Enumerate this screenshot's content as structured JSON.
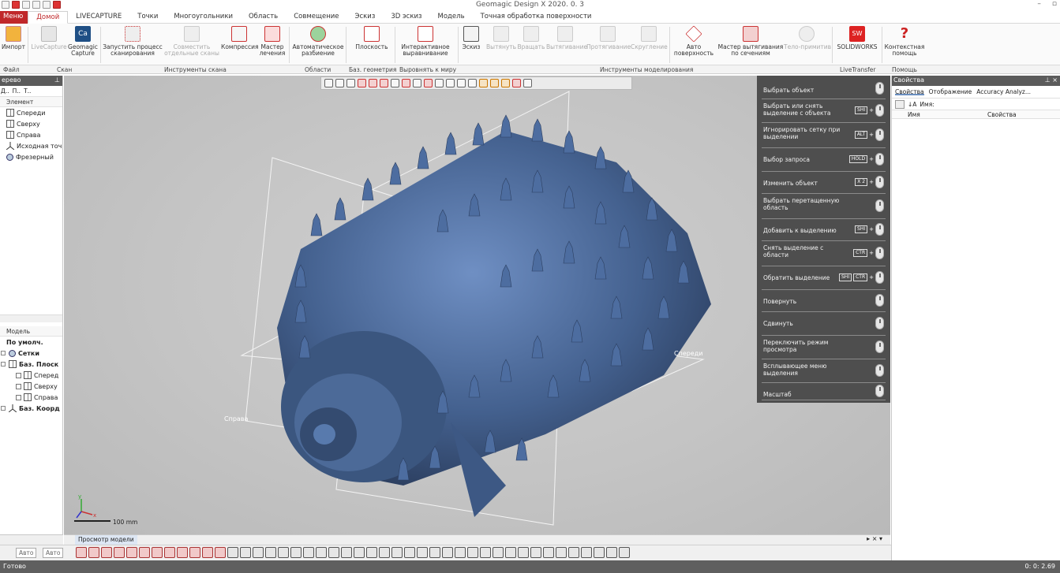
{
  "window": {
    "title": "Geomagic Design X 2020. 0. 3"
  },
  "tabs": [
    {
      "label": "Меню"
    },
    {
      "label": "Домой"
    },
    {
      "label": "LIVECAPTURE"
    },
    {
      "label": "Точки"
    },
    {
      "label": "Многоугольники"
    },
    {
      "label": "Область"
    },
    {
      "label": "Совмещение"
    },
    {
      "label": "Эскиз"
    },
    {
      "label": "3D эскиз"
    },
    {
      "label": "Модель"
    },
    {
      "label": "Точная обработка поверхности"
    }
  ],
  "ribbon": {
    "import": "Импорт",
    "livecapture": "LiveCapture",
    "geomagic_capture": "Geomagic Capture",
    "run_scan": "Запустить процесс сканирования",
    "combine_scans": "Совместить отдельные сканы",
    "compress": "Компрессия",
    "healing": "Мастер лечения",
    "auto_segment": "Автоматическое разбиение",
    "plane": "Плоскость",
    "interactive_align": "Интерактивное выравнивание",
    "sketch": "Эскиз",
    "extrude": "Вытянуть",
    "revolve": "Вращать",
    "sweep": "Вытягивание",
    "loft": "Протягивание",
    "fillet": "Скругление",
    "auto_surface": "Авто поверхность",
    "extract_wizard": "Мастер вытягивания по сечениям",
    "body_primitive": "Тело-примитив",
    "solidworks": "SOLIDWORKS",
    "context_help": "Контекстная помощь"
  },
  "groups": {
    "file": "Файл",
    "scan": "Скан",
    "scan_tools": "Инструменты скана",
    "regions": "Области",
    "base_geometry": "Баз. геометрия",
    "align_world": "Выровнять к миру",
    "modeling_tools": "Инструменты моделирования",
    "livetransfer": "LiveTransfer",
    "help": "Помощь"
  },
  "left_panel": {
    "title": "ерево",
    "tool_tabs": [
      "Д..",
      "П..",
      "Т.."
    ],
    "column": "Элемент",
    "tree": [
      "Спереди",
      "Сверху",
      "Справа",
      "Исходная точ",
      "Фрезерный"
    ],
    "model_header": "Модель",
    "model_tree": [
      {
        "label": "По умолч.",
        "bold": true
      },
      {
        "label": "Сетки",
        "bold": true
      },
      {
        "label": "Баз. Плоск",
        "bold": true
      },
      {
        "label": "Сперед",
        "bold": false
      },
      {
        "label": "Сверху",
        "bold": false
      },
      {
        "label": "Справа",
        "bold": false
      },
      {
        "label": "Баз. Коорд",
        "bold": true
      }
    ]
  },
  "viewport": {
    "labels": {
      "front": "Спереди",
      "right": "Справа"
    },
    "scale": "100 mm",
    "model_color": "#44618f",
    "view_tab": "Просмотр модели"
  },
  "mouse_help": [
    {
      "label": "Выбрать объект",
      "keys": []
    },
    {
      "label": "Выбрать или снять выделение с объекта",
      "keys": [
        "SHI"
      ]
    },
    {
      "label": "Игнорировать сетку при выделении",
      "keys": [
        "ALT"
      ]
    },
    {
      "label": "Выбор запроса",
      "keys": [
        "HOLD"
      ]
    },
    {
      "label": "Изменить объект",
      "keys": [
        "X 2"
      ]
    },
    {
      "label": "Выбрать перетащенную область",
      "keys": []
    },
    {
      "label": "Добавить к выделению",
      "keys": [
        "SHI"
      ]
    },
    {
      "label": "Снять выделение с области",
      "keys": [
        "CTR"
      ]
    },
    {
      "label": "Обратить выделение",
      "keys": [
        "SHI",
        "CTR"
      ]
    },
    {
      "label": "Повернуть",
      "keys": []
    },
    {
      "label": "Сдвинуть",
      "keys": []
    },
    {
      "label": "Переключить режим просмотра",
      "keys": []
    },
    {
      "label": "Всплывающее меню выделения",
      "keys": []
    },
    {
      "label": "Масштаб",
      "keys": []
    }
  ],
  "right_panel": {
    "title": "Свойства",
    "tabs": [
      "Свойства",
      "Отображение",
      "Accuracy Analyz..."
    ],
    "search_label": "Имя:",
    "col_name": "Имя",
    "col_props": "Свойства"
  },
  "bottom": {
    "select_a": "Авто",
    "select_b": "Авто"
  },
  "status": {
    "left": "Готово",
    "right": "0: 0: 2.69"
  }
}
